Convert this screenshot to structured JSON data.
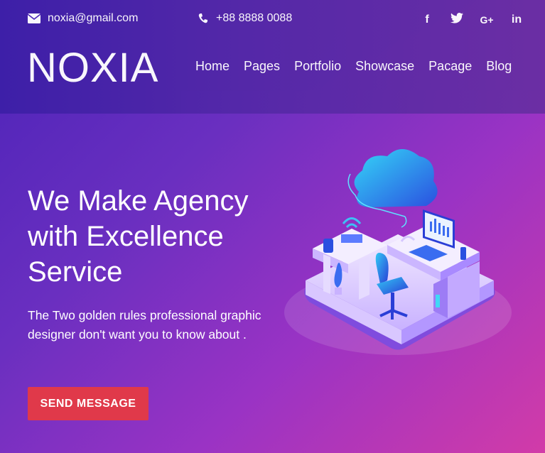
{
  "contact": {
    "email": "noxia@gmail.com",
    "phone": "+88 8888 0088"
  },
  "social": [
    {
      "icon": "facebook-icon",
      "glyph": "f"
    },
    {
      "icon": "twitter-icon",
      "glyph": "🐦"
    },
    {
      "icon": "google-plus-icon",
      "glyph": "G+"
    },
    {
      "icon": "linkedin-icon",
      "glyph": "in"
    }
  ],
  "brand": {
    "logo": "NOXIA"
  },
  "nav": [
    "Home",
    "Pages",
    "Portfolio",
    "Showcase",
    "Pacage",
    "Blog"
  ],
  "hero": {
    "title": "We Make Agency with Excellence Service",
    "text": "The Two golden rules professional graphic designer don't want you to know about .",
    "button": "SEND MESSAGE"
  },
  "colors": {
    "accent": "#e0394a",
    "gradient_start": "#4b23b8",
    "gradient_end": "#d23ba8"
  }
}
